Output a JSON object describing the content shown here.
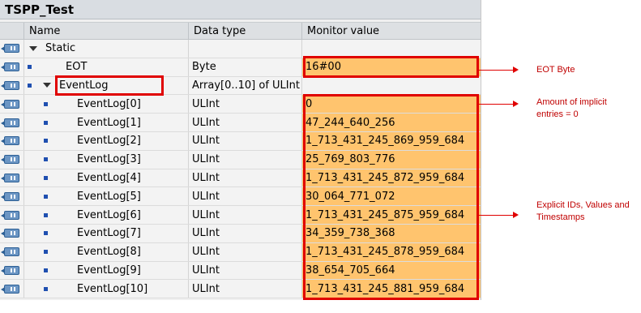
{
  "title": "TSPP_Test",
  "columns": {
    "name": "Name",
    "datatype": "Data type",
    "monitor": "Monitor value"
  },
  "rows": [
    {
      "name": "Static",
      "type": "",
      "value": "",
      "level": 0,
      "expander": true,
      "bullet": false,
      "filled": false
    },
    {
      "name": "EOT",
      "type": "Byte",
      "value": "16#00",
      "level": 1,
      "expander": false,
      "bullet": true,
      "filled": true
    },
    {
      "name": "EventLog",
      "type": "Array[0..10] of ULInt",
      "value": "",
      "level": 1,
      "expander": true,
      "bullet": true,
      "filled": false
    },
    {
      "name": "EventLog[0]",
      "type": "ULInt",
      "value": "0",
      "level": 2,
      "expander": false,
      "bullet": true,
      "filled": true
    },
    {
      "name": "EventLog[1]",
      "type": "ULInt",
      "value": "47_244_640_256",
      "level": 2,
      "expander": false,
      "bullet": true,
      "filled": true
    },
    {
      "name": "EventLog[2]",
      "type": "ULInt",
      "value": "1_713_431_245_869_959_684",
      "level": 2,
      "expander": false,
      "bullet": true,
      "filled": true
    },
    {
      "name": "EventLog[3]",
      "type": "ULInt",
      "value": "25_769_803_776",
      "level": 2,
      "expander": false,
      "bullet": true,
      "filled": true
    },
    {
      "name": "EventLog[4]",
      "type": "ULInt",
      "value": "1_713_431_245_872_959_684",
      "level": 2,
      "expander": false,
      "bullet": true,
      "filled": true
    },
    {
      "name": "EventLog[5]",
      "type": "ULInt",
      "value": "30_064_771_072",
      "level": 2,
      "expander": false,
      "bullet": true,
      "filled": true
    },
    {
      "name": "EventLog[6]",
      "type": "ULInt",
      "value": "1_713_431_245_875_959_684",
      "level": 2,
      "expander": false,
      "bullet": true,
      "filled": true
    },
    {
      "name": "EventLog[7]",
      "type": "ULInt",
      "value": "34_359_738_368",
      "level": 2,
      "expander": false,
      "bullet": true,
      "filled": true
    },
    {
      "name": "EventLog[8]",
      "type": "ULInt",
      "value": "1_713_431_245_878_959_684",
      "level": 2,
      "expander": false,
      "bullet": true,
      "filled": true
    },
    {
      "name": "EventLog[9]",
      "type": "ULInt",
      "value": "38_654_705_664",
      "level": 2,
      "expander": false,
      "bullet": true,
      "filled": true
    },
    {
      "name": "EventLog[10]",
      "type": "ULInt",
      "value": "1_713_431_245_881_959_684",
      "level": 2,
      "expander": false,
      "bullet": true,
      "filled": true
    }
  ],
  "annotations": {
    "eot": "EOT Byte",
    "implicit": "Amount of implicit entries = 0",
    "explicit": "Explicit IDs, Values and Timestamps"
  },
  "colors": {
    "monitor_fill": "#ffc46e",
    "highlight": "#e00000",
    "annotation_text": "#c00000"
  }
}
